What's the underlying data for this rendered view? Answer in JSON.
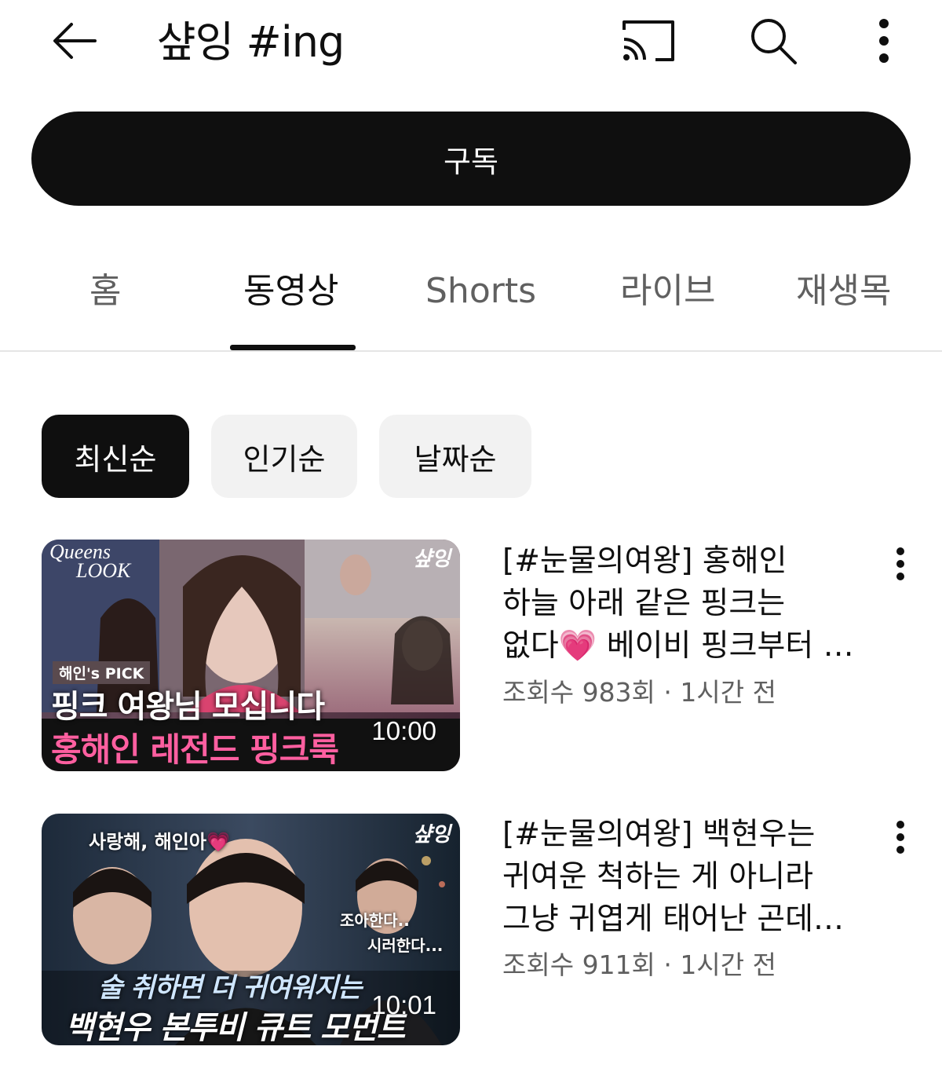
{
  "header": {
    "title": "샾잉 #ing",
    "icons": [
      "back-arrow-icon",
      "cast-icon",
      "search-icon",
      "more-vertical-icon"
    ]
  },
  "subscribe_label": "구독",
  "tabs": [
    {
      "label": "홈",
      "active": false
    },
    {
      "label": "동영상",
      "active": true
    },
    {
      "label": "Shorts",
      "active": false
    },
    {
      "label": "라이브",
      "active": false
    },
    {
      "label": "재생목",
      "active": false
    }
  ],
  "chips": [
    {
      "label": "최신순",
      "selected": true
    },
    {
      "label": "인기순",
      "selected": false
    },
    {
      "label": "날짜순",
      "selected": false
    }
  ],
  "videos": [
    {
      "title_lines": [
        "[#눈물의여왕] 홍해인",
        "하늘 아래 같은 핑크는",
        "없다💗 베이비 핑크부터 …"
      ],
      "meta": "조회수 983회 · 1시간 전",
      "duration": "10:00",
      "thumb_text": {
        "logo_top": "Queens",
        "logo_bottom": "LOOK",
        "channel_mark": "샾잉",
        "tag": "해인's PICK",
        "line1": "핑크 여왕님 모십니다",
        "line2": "홍해인 레전드 핑크룩"
      }
    },
    {
      "title_lines": [
        "[#눈물의여왕] 백현우는",
        "귀여운 척하는 게 아니라",
        "그냥 귀엽게 태어난 곤데…"
      ],
      "meta": "조회수 911회 · 1시간 전",
      "duration": "10:01",
      "thumb_text": {
        "channel_mark": "샾잉",
        "quote": "사랑해, 해인아💗",
        "side1": "조아한다..",
        "side2": "시러한다...",
        "line1": "술 취하면 더 귀여워지는",
        "line2": "백현우 본투비 큐트 모먼트"
      }
    }
  ],
  "colors": {
    "accent_pink": "#ff5fa0",
    "text_primary": "#0f0f0f",
    "text_secondary": "#606060",
    "chip_bg": "#f2f2f2"
  }
}
